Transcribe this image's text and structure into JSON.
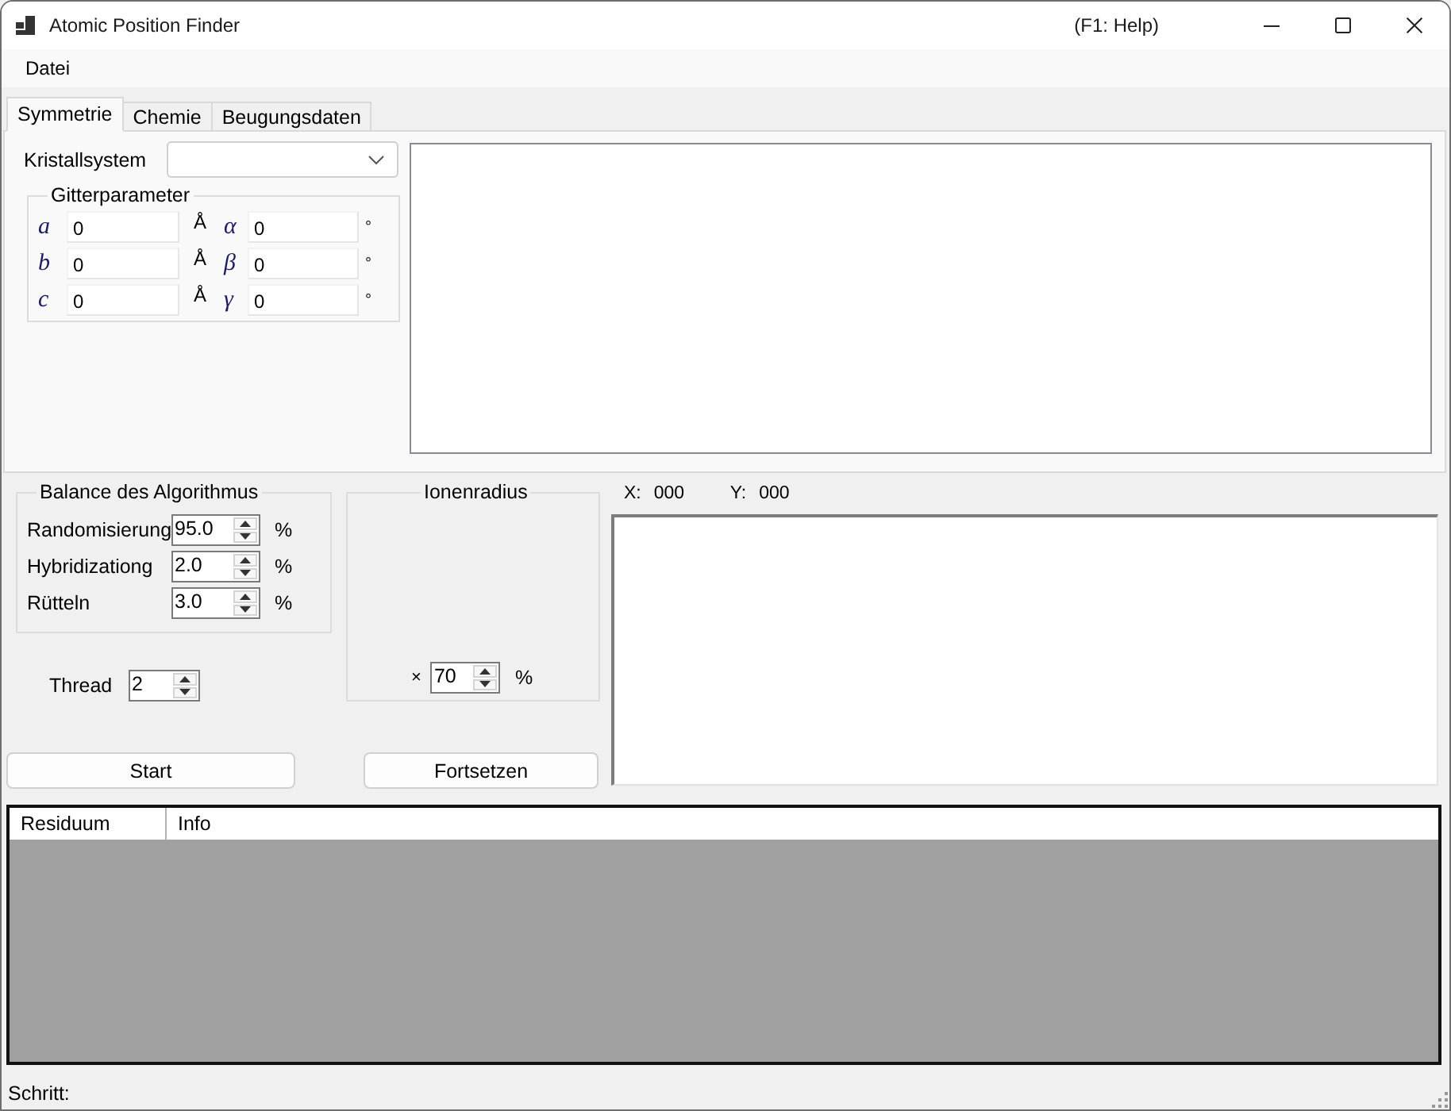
{
  "window": {
    "title": "Atomic Position Finder",
    "help_hint": "(F1: Help)"
  },
  "menu": [
    "Datei"
  ],
  "tabs": [
    {
      "label": "Symmetrie",
      "selected": true
    },
    {
      "label": "Chemie",
      "selected": false
    },
    {
      "label": "Beugungsdaten",
      "selected": false
    }
  ],
  "symmetry": {
    "crystal_system": {
      "label": "Kristallsystem"
    },
    "lattice": {
      "title": "Gitterparameter",
      "rows": [
        {
          "length": {
            "symbol": "a",
            "value": "0",
            "unit": "Å"
          },
          "angle": {
            "symbol": "α",
            "value": "0",
            "unit": "°"
          }
        },
        {
          "length": {
            "symbol": "b",
            "value": "0",
            "unit": "Å"
          },
          "angle": {
            "symbol": "β",
            "value": "0",
            "unit": "°"
          }
        },
        {
          "length": {
            "symbol": "c",
            "value": "0",
            "unit": "Å"
          },
          "angle": {
            "symbol": "γ",
            "value": "0",
            "unit": "°"
          }
        }
      ]
    }
  },
  "balance": {
    "title": "Balance des Algorithmus",
    "rows": [
      {
        "label": "Randomisierung",
        "value": "95.0",
        "unit": "%"
      },
      {
        "label": "Hybridizationg",
        "value": "2.0",
        "unit": "%"
      },
      {
        "label": "Rütteln",
        "value": "3.0",
        "unit": "%"
      }
    ]
  },
  "thread": {
    "label": "Thread",
    "value": "2"
  },
  "ion_radius": {
    "title": "Ionenradius",
    "factor": {
      "sign": "×",
      "value": "70",
      "unit": "%"
    }
  },
  "coordinates": [
    {
      "label": "X:",
      "value": "000"
    },
    {
      "label": "Y:",
      "value": "000"
    }
  ],
  "buttons": [
    "Start",
    "Fortsetzen"
  ],
  "table": {
    "columns": [
      "Residuum",
      "Info"
    ]
  },
  "status_bar": {
    "label": "Schritt:"
  }
}
